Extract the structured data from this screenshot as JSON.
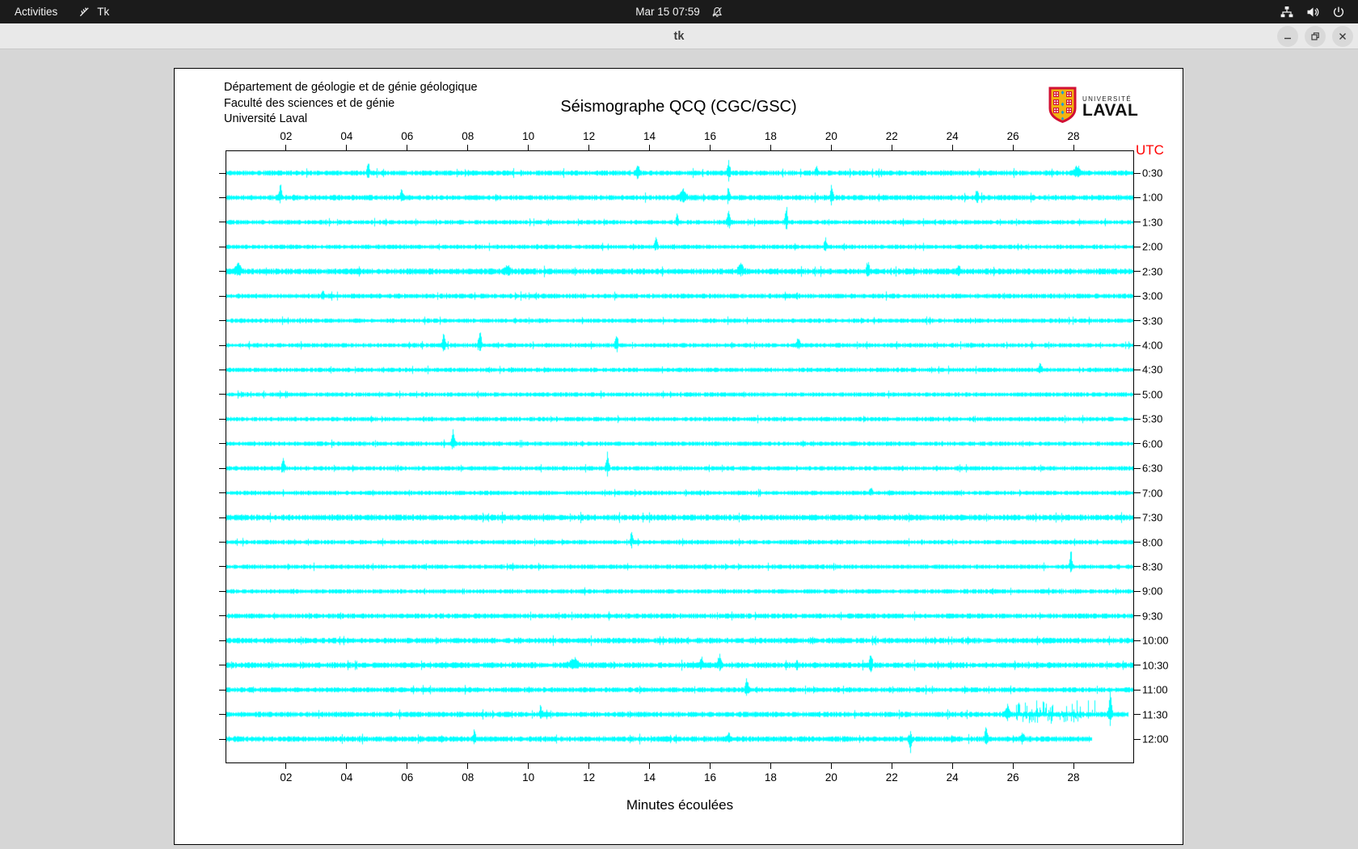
{
  "desktop": {
    "topbar": {
      "activities_label": "Activities",
      "app_menu_label": "Tk",
      "clock": "Mar 15  07:59",
      "icons": [
        "tk-feather-icon",
        "notifications-disabled-icon",
        "network-icon",
        "volume-icon",
        "power-icon"
      ]
    },
    "window": {
      "title": "tk",
      "controls": [
        "minimize",
        "restore",
        "close"
      ]
    }
  },
  "app": {
    "header_lines": [
      "Département de géologie et de génie géologique",
      "Faculté des sciences et de génie",
      "Université Laval"
    ],
    "logo": {
      "line1": "UNIVERSITÉ",
      "line2": "LAVAL"
    }
  },
  "chart_data": {
    "type": "line",
    "subtype": "helicorder-seismogram",
    "title": "Séismographe QCQ (CGC/GSC)",
    "xlabel": "Minutes écoulées",
    "right_axis_label": "UTC",
    "x_range_minutes": [
      0,
      30
    ],
    "x_tick_labels": [
      "02",
      "04",
      "06",
      "08",
      "10",
      "12",
      "14",
      "16",
      "18",
      "20",
      "22",
      "24",
      "26",
      "28"
    ],
    "x_ticks_shown": "top and bottom",
    "grid": false,
    "trace_color": "#00ffff",
    "traces": [
      {
        "label": "0:30",
        "noise": 1.15,
        "events": [
          {
            "m": 4.7,
            "a": 12
          },
          {
            "m": 13.6,
            "a": 13
          },
          {
            "m": 16.6,
            "a": 18
          },
          {
            "m": 19.5,
            "a": 8
          },
          {
            "m": 28.1,
            "a": 8,
            "s": 3
          }
        ]
      },
      {
        "label": "1:00",
        "noise": 1.2,
        "events": [
          {
            "m": 1.8,
            "a": 16
          },
          {
            "m": 5.8,
            "a": 10
          },
          {
            "m": 15.1,
            "a": 9,
            "s": 3
          },
          {
            "m": 16.6,
            "a": 10
          },
          {
            "m": 20.0,
            "a": 12
          },
          {
            "m": 24.8,
            "a": 9
          }
        ]
      },
      {
        "label": "1:30",
        "noise": 1.0,
        "events": [
          {
            "m": 14.9,
            "a": 9
          },
          {
            "m": 16.6,
            "a": 16
          },
          {
            "m": 18.5,
            "a": 18
          }
        ]
      },
      {
        "label": "2:00",
        "noise": 1.0,
        "events": [
          {
            "m": 14.2,
            "a": 15
          },
          {
            "m": 19.8,
            "a": 10
          }
        ]
      },
      {
        "label": "2:30",
        "noise": 1.35,
        "events": [
          {
            "m": 0.4,
            "a": 8,
            "s": 3
          },
          {
            "m": 9.3,
            "a": 7,
            "s": 2.5
          },
          {
            "m": 17.0,
            "a": 8,
            "s": 2.5
          },
          {
            "m": 21.2,
            "a": 12
          },
          {
            "m": 24.2,
            "a": 8
          }
        ]
      },
      {
        "label": "3:00",
        "noise": 1.1,
        "events": [
          {
            "m": 3.2,
            "a": 6
          }
        ]
      },
      {
        "label": "3:30",
        "noise": 1.0,
        "events": []
      },
      {
        "label": "4:00",
        "noise": 1.0,
        "events": [
          {
            "m": 7.2,
            "a": 16
          },
          {
            "m": 8.4,
            "a": 18
          },
          {
            "m": 12.9,
            "a": 16
          },
          {
            "m": 18.9,
            "a": 10
          }
        ]
      },
      {
        "label": "4:30",
        "noise": 1.0,
        "events": [
          {
            "m": 26.9,
            "a": 9
          }
        ]
      },
      {
        "label": "5:00",
        "noise": 1.0,
        "events": []
      },
      {
        "label": "5:30",
        "noise": 1.0,
        "events": []
      },
      {
        "label": "6:00",
        "noise": 1.0,
        "events": [
          {
            "m": 7.5,
            "a": 20
          }
        ]
      },
      {
        "label": "6:30",
        "noise": 1.0,
        "events": [
          {
            "m": 1.9,
            "a": 14
          },
          {
            "m": 12.6,
            "a": 20
          }
        ]
      },
      {
        "label": "7:00",
        "noise": 1.0,
        "events": [
          {
            "m": 21.3,
            "a": 7
          }
        ]
      },
      {
        "label": "7:30",
        "noise": 1.35,
        "events": []
      },
      {
        "label": "8:00",
        "noise": 1.0,
        "events": [
          {
            "m": 13.4,
            "a": 12
          }
        ]
      },
      {
        "label": "8:30",
        "noise": 1.0,
        "events": [
          {
            "m": 27.9,
            "a": 20
          }
        ]
      },
      {
        "label": "9:00",
        "noise": 1.0,
        "events": []
      },
      {
        "label": "9:30",
        "noise": 1.15,
        "events": []
      },
      {
        "label": "10:00",
        "noise": 1.25,
        "events": []
      },
      {
        "label": "10:30",
        "noise": 1.3,
        "events": [
          {
            "m": 11.5,
            "a": 8,
            "s": 4
          },
          {
            "m": 15.7,
            "a": 10
          },
          {
            "m": 16.3,
            "a": 15
          },
          {
            "m": 21.3,
            "a": 16
          }
        ]
      },
      {
        "label": "11:00",
        "noise": 1.15,
        "events": [
          {
            "m": 17.2,
            "a": 18
          }
        ]
      },
      {
        "label": "11:30",
        "noise": 1.2,
        "end": 29.8,
        "events": [
          {
            "m": 10.4,
            "a": 10
          },
          {
            "m": 25.8,
            "a": 12,
            "s": 2
          },
          {
            "m": 27.4,
            "a": 24,
            "burst": true,
            "w": 1.3
          },
          {
            "m": 29.2,
            "a": 30
          }
        ]
      },
      {
        "label": "12:00",
        "noise": 1.25,
        "end": 28.6,
        "events": [
          {
            "m": 8.2,
            "a": 10
          },
          {
            "m": 16.6,
            "a": 7
          },
          {
            "m": 22.6,
            "a": 18,
            "dir": "down"
          },
          {
            "m": 25.1,
            "a": 14
          },
          {
            "m": 26.3,
            "a": 8,
            "s": 2
          }
        ]
      }
    ]
  },
  "colors": {
    "trace": "#00ffff",
    "utc_red": "#ff0000",
    "topbar_bg": "#1b1b1b",
    "titlebar_bg": "#e9e9e9",
    "workspace_bg": "#d6d6d6",
    "panel_bg": "#ffffff",
    "laval_red": "#d21034",
    "laval_gold": "#f2b411",
    "laval_blue": "#1b9dd9"
  }
}
